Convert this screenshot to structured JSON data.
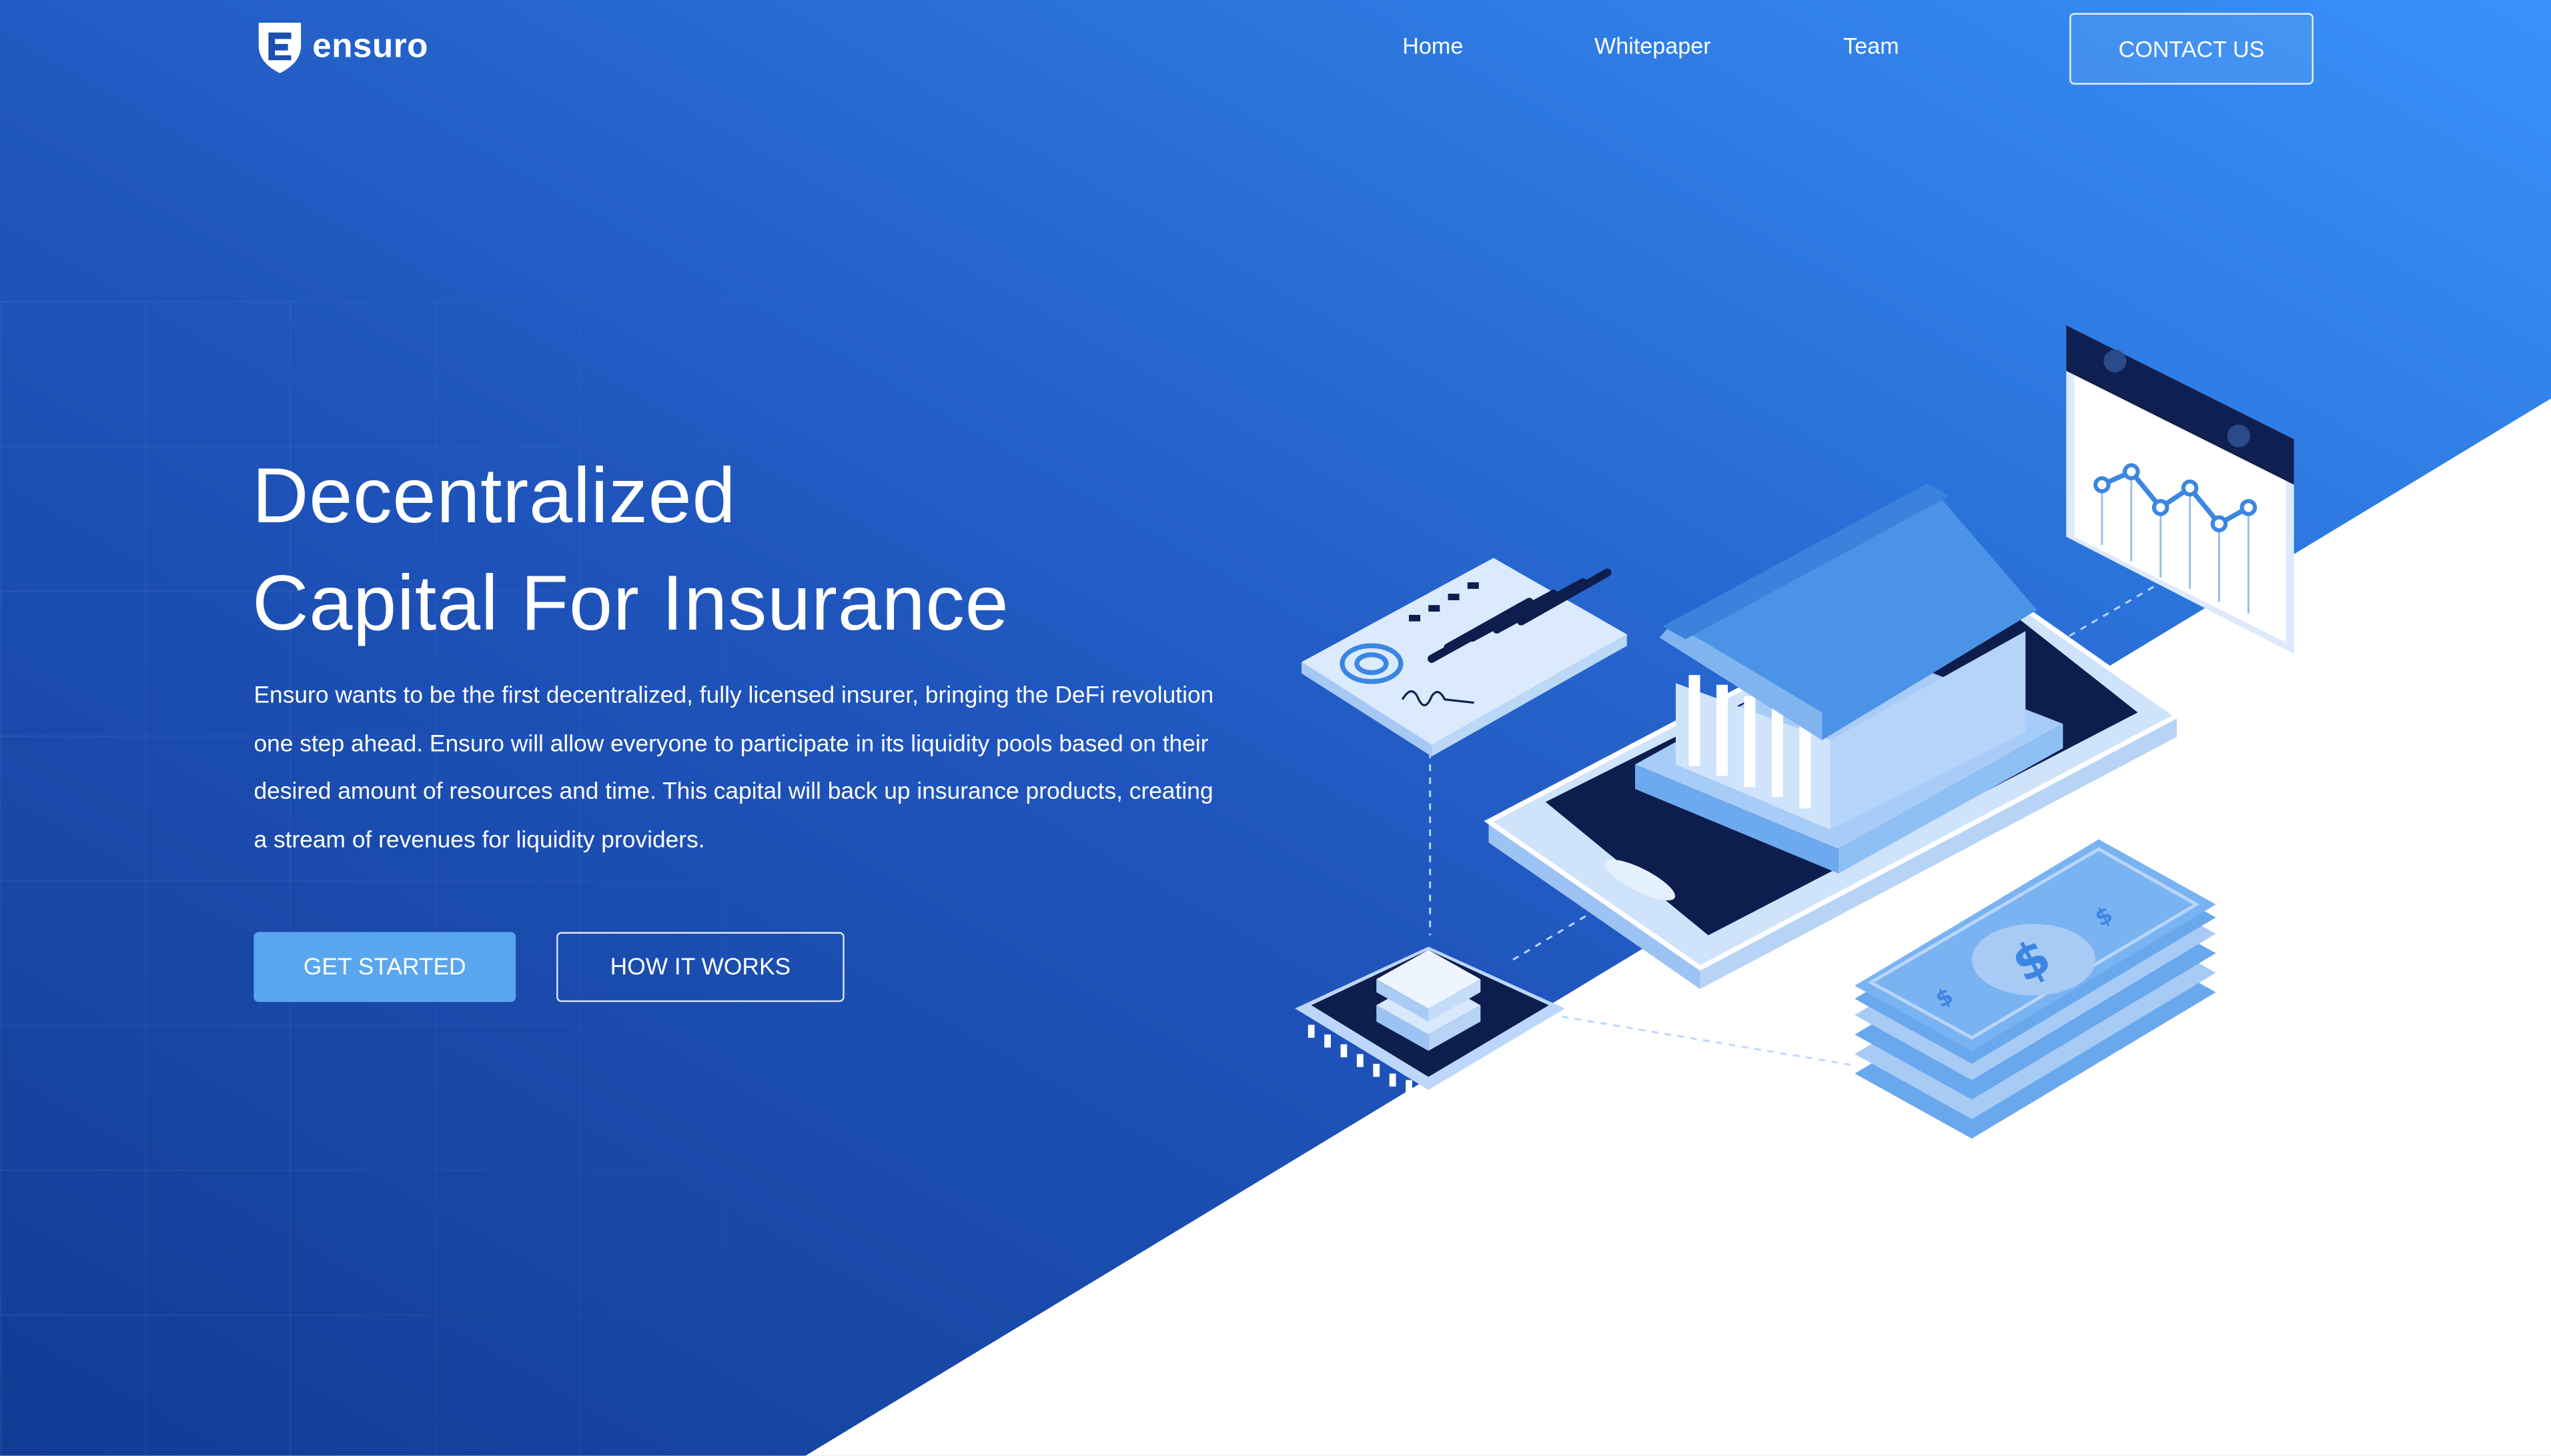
{
  "brand": {
    "name": "ensuro",
    "logo_icon": "ensuro-shield-icon"
  },
  "nav": {
    "links": [
      "Home",
      "Whitepaper",
      "Team"
    ],
    "contact_label": "CONTACT US"
  },
  "hero": {
    "title_line1": "Decentralized",
    "title_line2": "Capital For Insurance",
    "description": "Ensuro wants to be the first decentralized, fully licensed insurer, bringing the DeFi revolution one step ahead. Ensuro will allow everyone to participate in its liquidity pools based on their desired amount of resources and time. This capital will back up insurance products, creating a stream of revenues for liquidity providers.",
    "primary_cta": "GET STARTED",
    "secondary_cta": "HOW IT WORKS"
  },
  "colors": {
    "gradient_start": "#1846a3",
    "gradient_end": "#3389f7",
    "accent": "#5aa6ee",
    "dark_navy": "#0e1f52"
  },
  "illustration": {
    "icons": [
      "document-icon",
      "bank-building-icon",
      "tablet-icon",
      "chart-window-icon",
      "chip-icon",
      "cash-stack-icon"
    ],
    "currency_symbol": "$"
  }
}
